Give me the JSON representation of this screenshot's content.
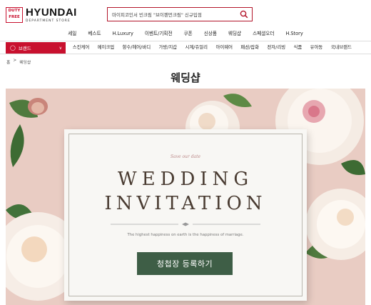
{
  "header": {
    "logo_badge": [
      "DUTY",
      "FREE"
    ],
    "logo_main": "HYUNDAI",
    "logo_sub": "DEPARTMENT STORE",
    "search_placeholder": "마이피코인서 빈크림 \"브이펜먼크림\" 신규입점",
    "search_icon": "search-icon",
    "accent_color": "#c8102e"
  },
  "top_nav": [
    "세일",
    "베스트",
    "H.Luxury",
    "이벤트/기획전",
    "쿠폰",
    "신상품",
    "웨딩샵",
    "스페셜오더",
    "H.Story"
  ],
  "category_bar": {
    "brand_label": "브랜드",
    "categories": [
      "스킨케어",
      "메이크업",
      "향수/헤어/바디",
      "가방/지갑",
      "시계/쥬얼리",
      "아이웨어",
      "패션/잡화",
      "전자/리빙",
      "식품",
      "유아동",
      "국내브랜드"
    ]
  },
  "breadcrumb": {
    "home": "홈",
    "separator": ">",
    "current": "웨딩샵"
  },
  "page": {
    "title": "웨딩샵"
  },
  "banner": {
    "save_the_date": "Save our date",
    "headline_line1": "WEDDING",
    "headline_line2": "INVITATION",
    "tagline": "The highest happiness on earth is the happiness of marriage.",
    "cta_label": "청첩장 등록하기",
    "cta_color": "#3e5e46",
    "background_color": "#e9ccc3"
  }
}
